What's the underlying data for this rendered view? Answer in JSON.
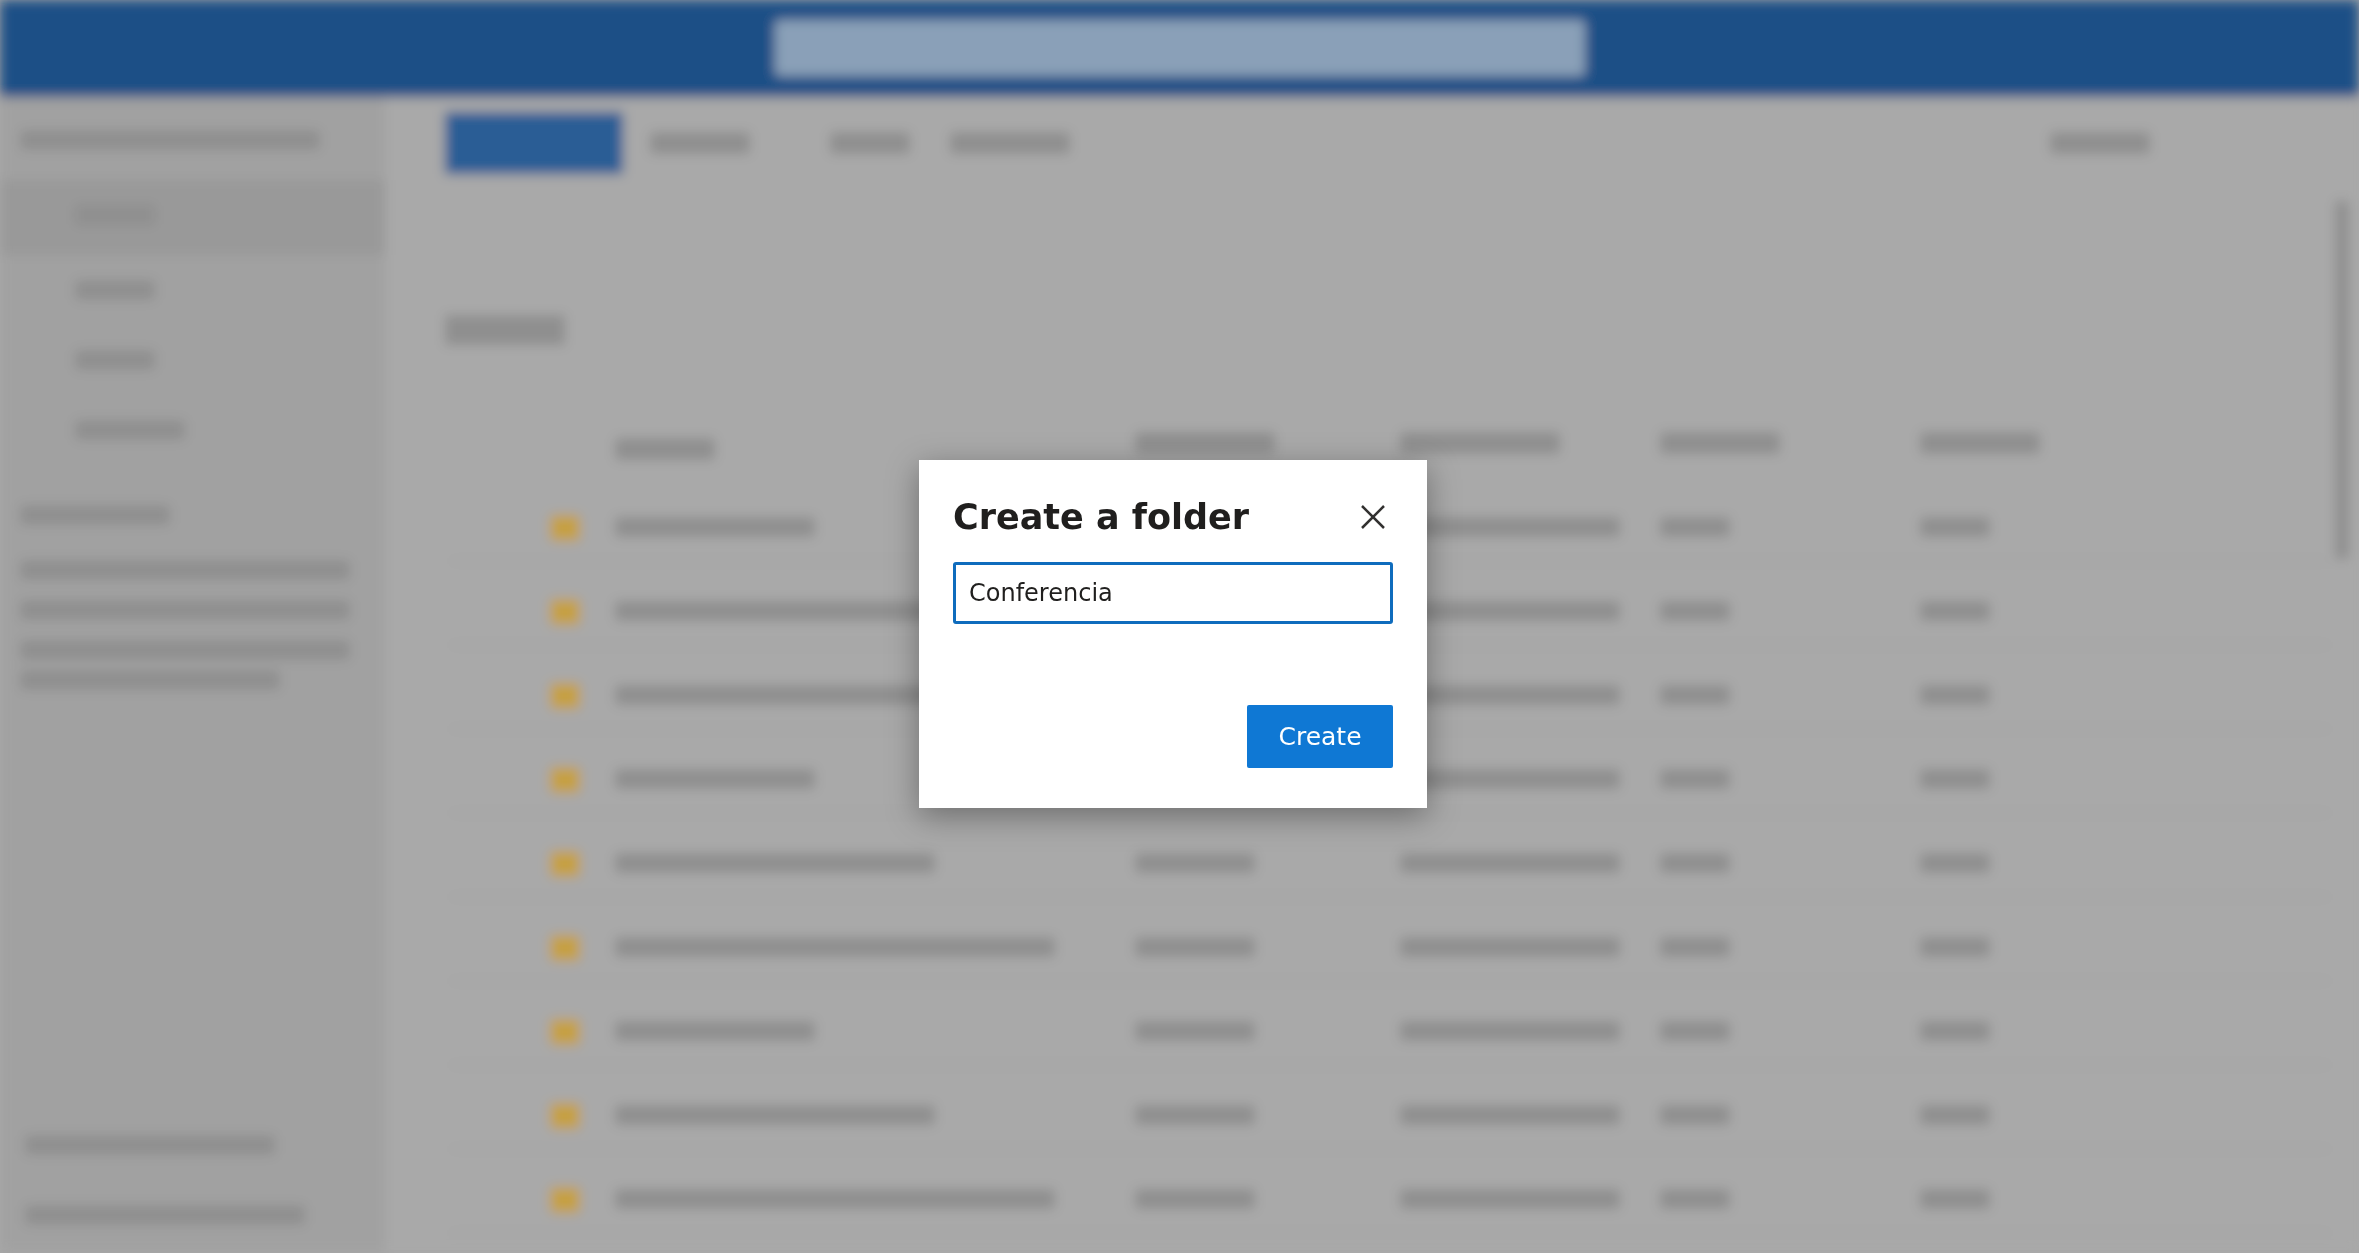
{
  "dialog": {
    "title": "Create a folder",
    "field": {
      "value": "Conferencia",
      "focused": true
    },
    "buttons": [
      {
        "label": "Create",
        "kind": "primary"
      }
    ]
  }
}
